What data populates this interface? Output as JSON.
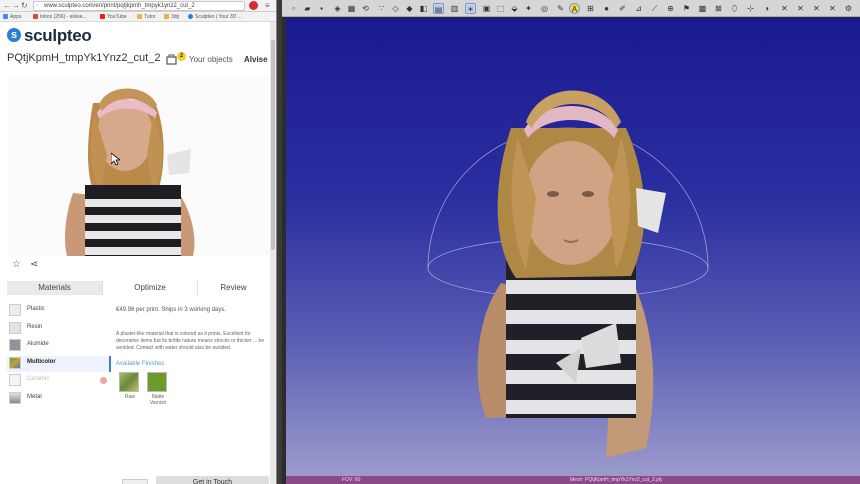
{
  "browser": {
    "url": "www.sculpteo.com/en/print/pqtjkpmh_tmpyk1ynz2_cut_2",
    "bookmarks": [
      {
        "label": "Apps",
        "color": "#4285f4"
      },
      {
        "label": "Inbox (256) - alvise...",
        "color": "#d54b3d"
      },
      {
        "label": "YouTube",
        "color": "#e62117"
      },
      {
        "label": "Tutor",
        "color": "#e4b73a"
      },
      {
        "label": "3dp",
        "color": "#e4b73a"
      },
      {
        "label": "Sculpteo | Your 3D ...",
        "color": "#2a7ed6"
      }
    ]
  },
  "site": {
    "brand": "sculpteo",
    "model_title": "PQtjKpmH_tmpYk1Ynz2_cut_2",
    "cart_count": "2",
    "your_objects": "Your objects",
    "user_name": "Alvise"
  },
  "tabs": [
    "Materials",
    "Optimize",
    "Review"
  ],
  "materials": [
    {
      "label": "Plastic",
      "color": "#ececec"
    },
    {
      "label": "Resin",
      "color": "#e6e2da"
    },
    {
      "label": "Alumide",
      "color": "#8f949b"
    },
    {
      "label": "Multicolor",
      "color": "#7fa040"
    },
    {
      "label": "Ceramic",
      "color": "#f4f4f4"
    },
    {
      "label": "Metal",
      "color": "#b7b7b7"
    }
  ],
  "material_detail": {
    "price": "€49.96 per print. Ships in 3 working days.",
    "description": "A plaster-like material that is colored as it prints. Excellent for decorative items but its brittle nature means shocks or thicker ... be avoided. Contact with water should also be avoided.",
    "finishes_title": "Available Finishes",
    "finishes": [
      {
        "label": "Raw",
        "color": "#8ea35a"
      },
      {
        "label": "Matte Varnish",
        "color": "#6e9a2a"
      }
    ]
  },
  "cta": "Get in Touch",
  "viewer": {
    "status_left": "FOV: 60",
    "status_mid": "Mesh: PQtjKpmH_tmpYk1Ynz2_cut_2.ply"
  },
  "colors": {
    "accent": "#2a7ed6",
    "viewer_bg_top": "#1a1a90",
    "viewer_bg_bottom": "#9b9bcb",
    "statusbar": "#8a4a8a"
  }
}
